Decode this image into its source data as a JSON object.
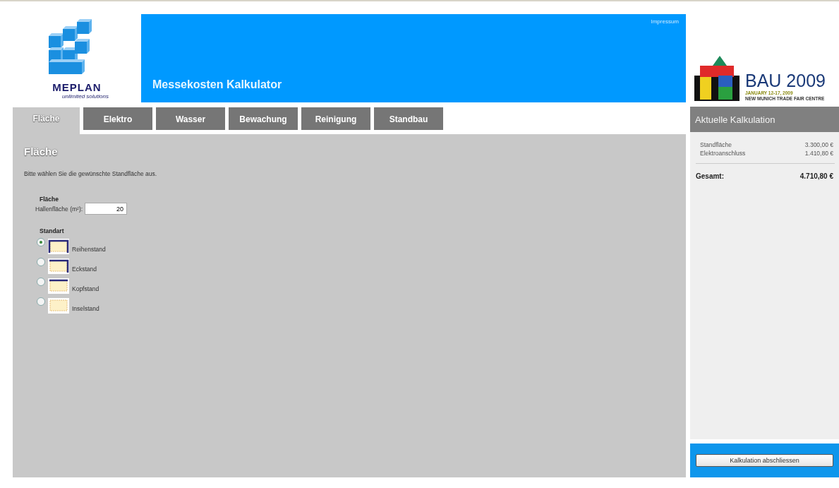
{
  "logo": {
    "name": "MEPLAN",
    "tagline": "unlimited solutions"
  },
  "header": {
    "title": "Messekosten Kalkulator",
    "link": "Impressum"
  },
  "event_logo": {
    "name": "BAU 2009",
    "dates": "JANUARY 12-17, 2009",
    "venue": "NEW MUNICH TRADE FAIR CENTRE"
  },
  "tabs": [
    {
      "label": "Fläche",
      "selected": true
    },
    {
      "label": "Elektro",
      "selected": false
    },
    {
      "label": "Wasser",
      "selected": false
    },
    {
      "label": "Bewachung",
      "selected": false
    },
    {
      "label": "Reinigung",
      "selected": false
    },
    {
      "label": "Standbau",
      "selected": false
    }
  ],
  "content": {
    "heading": "Fläche",
    "intro": "Bitte wählen Sie die gewünschte Standfläche aus.",
    "area": {
      "heading": "Fläche",
      "label": "Hallenfläche (m²):",
      "value": "20"
    },
    "stand_type": {
      "heading": "Standart",
      "options": [
        {
          "label": "Reihenstand",
          "kind": "row",
          "selected": true
        },
        {
          "label": "Eckstand",
          "kind": "corner",
          "selected": false
        },
        {
          "label": "Kopfstand",
          "kind": "head",
          "selected": false
        },
        {
          "label": "Inselstand",
          "kind": "island",
          "selected": false
        }
      ]
    }
  },
  "summary": {
    "title": "Aktuelle Kalkulation",
    "items": [
      {
        "label": "Standfläche",
        "amount": "3.300,00 €"
      },
      {
        "label": "Elektroanschluss",
        "amount": "1.410,80 €"
      }
    ],
    "total_label": "Gesamt:",
    "total": "4.710,80 €",
    "button": "Kalkulation abschliessen"
  }
}
